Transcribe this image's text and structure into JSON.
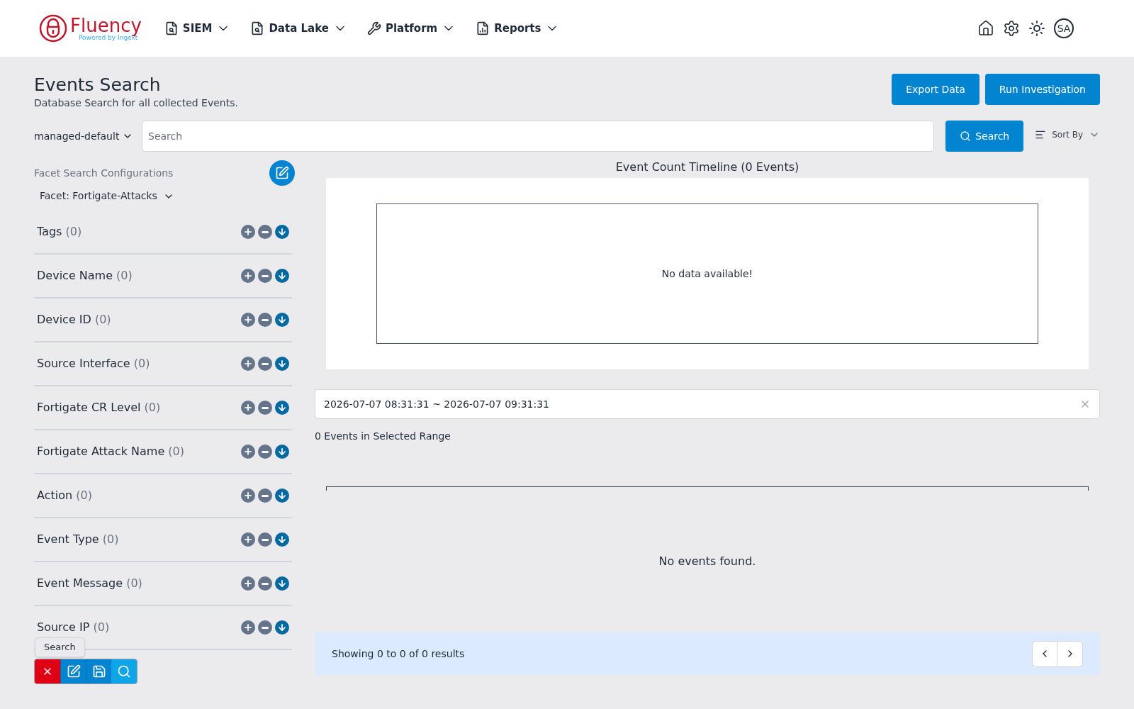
{
  "brand": {
    "name": "Fluency",
    "tagline": "Powered by Ingext"
  },
  "nav": [
    {
      "label": "SIEM"
    },
    {
      "label": "Data Lake"
    },
    {
      "label": "Platform"
    },
    {
      "label": "Reports"
    }
  ],
  "user": {
    "initials": "SA"
  },
  "page": {
    "title": "Events Search",
    "subtitle": "Database Search for all collected Events.",
    "buttons": [
      "Export Data",
      "Run Investigation"
    ]
  },
  "search": {
    "scope": "managed-default",
    "placeholder": "Search",
    "button": "Search",
    "sort": "Sort By"
  },
  "facets": {
    "title": "Facet Search Configurations",
    "config": "Facet: Fortigate-Attacks",
    "items": [
      {
        "label": "Tags",
        "count": "(0)"
      },
      {
        "label": "Device Name",
        "count": "(0)"
      },
      {
        "label": "Device ID",
        "count": "(0)"
      },
      {
        "label": "Source Interface",
        "count": "(0)"
      },
      {
        "label": "Fortigate CR Level",
        "count": "(0)"
      },
      {
        "label": "Fortigate Attack Name",
        "count": "(0)"
      },
      {
        "label": "Action",
        "count": "(0)"
      },
      {
        "label": "Event Type",
        "count": "(0)"
      },
      {
        "label": "Event Message",
        "count": "(0)"
      },
      {
        "label": "Source IP",
        "count": "(0)"
      }
    ],
    "tooltip": "Search"
  },
  "timeline": {
    "title": "Event Count Timeline (0 Events)",
    "empty": "No data available!"
  },
  "range": {
    "value": "2026-07-07 08:31:31 ~ 2026-07-07 09:31:31",
    "summary": "0 Events in Selected Range"
  },
  "results": {
    "empty": "No events found.",
    "showing": "Showing 0 to 0 of 0 results"
  }
}
